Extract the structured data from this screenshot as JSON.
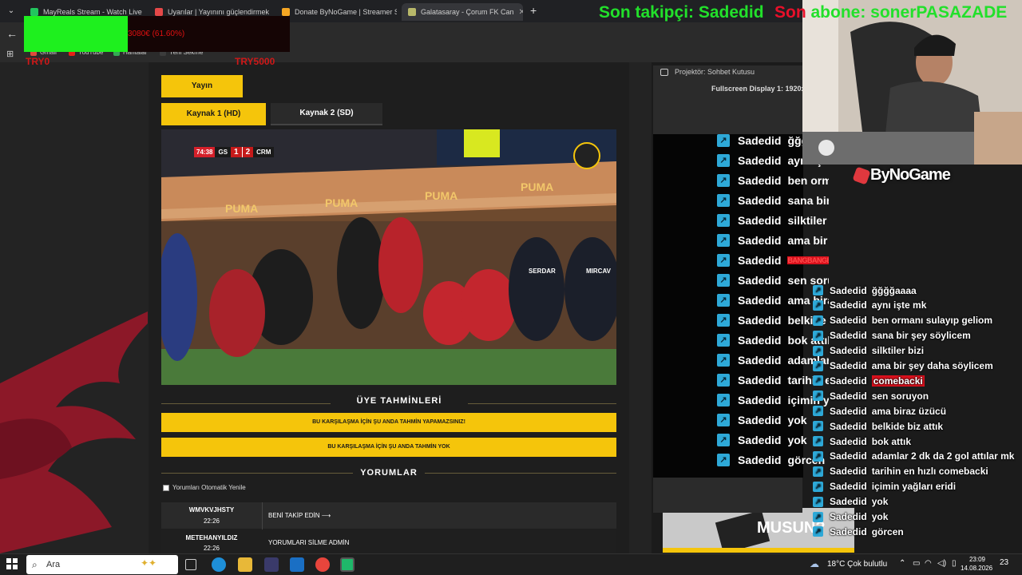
{
  "browser": {
    "tabs": [
      {
        "title": "MayReals Stream - Watch Live",
        "favicon_color": "#22c55e"
      },
      {
        "title": "Uyarılar | Yayınını güçlendirmek",
        "favicon_color": "#e54848"
      },
      {
        "title": "Donate ByNoGame | Streamer S",
        "favicon_color": "#f5a623"
      },
      {
        "title": "Galatasaray - Çorum FK Can",
        "favicon_color": "#b8b86a"
      }
    ],
    "bookmarks": [
      "Gmail",
      "YouTube",
      "Haritalar",
      "Yeni Sekme"
    ]
  },
  "goal": {
    "amount_text": "3080€ (61.60%)",
    "progress": 0.616,
    "left_label": "TRY0",
    "right_label": "TRY5000"
  },
  "alerts": {
    "follower": "Son takipçi: Sadedid",
    "subscriber_prefix": "Son",
    "subscriber_rest": " abone: sonerPASAZADE"
  },
  "page": {
    "stream_button": "Yayın",
    "source_hd": "Kaynak 1 (HD)",
    "source_sd": "Kaynak 2 (SD)",
    "predictions_title": "ÜYE TAHMİNLERİ",
    "prediction_notice_1": "BU KARŞILAŞMA İÇİN ŞU ANDA TAHMİN YAPAMAZSINIZ!",
    "prediction_notice_2": "BU KARŞILAŞMA İÇİN ŞU ANDA TAHMİN YOK",
    "comments_title": "YORUMLAR",
    "auto_refresh_label": "Yorumları Otomatik Yenile",
    "comments": [
      {
        "user": "WMVKVJHSTY",
        "time": "22:26",
        "text": "BENİ TAKİP EDİN ⟶"
      },
      {
        "user": "METEHANYILDIZ",
        "time": "22:26",
        "text": "YORUMLARI SİLME ADMİN"
      }
    ],
    "ad_text": "MUSUN?"
  },
  "video": {
    "minute": "74:38",
    "home": "GS",
    "home_score": "1",
    "away_score": "2",
    "away": "CRM",
    "shirt_texts": [
      "SERDAR",
      "MIRCAV"
    ],
    "ad_board": "PUMA"
  },
  "projector": {
    "title": "Projektör: Sohbet Kutusu",
    "display": "Fullscreen Display 1: 1920x"
  },
  "chat_big": [
    {
      "user": "Sadedid",
      "msg": "ğğğaaaa"
    },
    {
      "user": "Sadedid",
      "msg": "aynı işte mk"
    },
    {
      "user": "Sadedid",
      "msg": "ben ormanı sulayıp geliom"
    },
    {
      "user": "Sadedid",
      "msg": "sana bir şey söylicem"
    },
    {
      "user": "Sadedid",
      "msg": "silktiler bizi"
    },
    {
      "user": "Sadedid",
      "msg": "ama bir şey daha söylicem"
    },
    {
      "user": "Sadedid",
      "msg": "BANGBANGBANGBANGBANG",
      "red": true
    },
    {
      "user": "Sadedid",
      "msg": "sen soruyon"
    },
    {
      "user": "Sadedid",
      "msg": "ama biraz üzücü"
    },
    {
      "user": "Sadedid",
      "msg": "belkide biz attık"
    },
    {
      "user": "Sadedid",
      "msg": "bok attık"
    },
    {
      "user": "Sadedid",
      "msg": "adamlar 2 dk da 2 gol attılar mk"
    },
    {
      "user": "Sadedid",
      "msg": "tarihin en hızlı comebacki"
    },
    {
      "user": "Sadedid",
      "msg": "içimin yağları eridi"
    },
    {
      "user": "Sadedid",
      "msg": "yok"
    },
    {
      "user": "Sadedid",
      "msg": "yok"
    },
    {
      "user": "Sadedid",
      "msg": "görcen"
    }
  ],
  "chat_small": [
    {
      "user": "Sadedid",
      "msg": "ğğğğaaaa"
    },
    {
      "user": "Sadedid",
      "msg": "aynı işte mk"
    },
    {
      "user": "Sadedid",
      "msg": "ben ormanı sulayıp geliom"
    },
    {
      "user": "Sadedid",
      "msg": "sana bir şey söylicem"
    },
    {
      "user": "Sadedid",
      "msg": "silktiler bizi"
    },
    {
      "user": "Sadedid",
      "msg": "ama bir şey daha söylicem"
    },
    {
      "user": "Sadedid",
      "msg": "comebacki",
      "red": true
    },
    {
      "user": "Sadedid",
      "msg": "sen soruyon"
    },
    {
      "user": "Sadedid",
      "msg": "ama biraz üzücü"
    },
    {
      "user": "Sadedid",
      "msg": "belkide biz attık"
    },
    {
      "user": "Sadedid",
      "msg": "bok attık"
    },
    {
      "user": "Sadedid",
      "msg": "adamlar 2 dk da 2 gol attılar mk"
    },
    {
      "user": "Sadedid",
      "msg": "tarihin en hızlı comebacki"
    },
    {
      "user": "Sadedid",
      "msg": "içimin yağları eridi"
    },
    {
      "user": "Sadedid",
      "msg": "yok"
    },
    {
      "user": "Sadedid",
      "msg": "yok"
    },
    {
      "user": "Sadedid",
      "msg": "görcen"
    }
  ],
  "webcam": {
    "logo_text": "ByNoGame"
  },
  "taskbar": {
    "search_placeholder": "Ara",
    "weather": "18°C  Çok bulutlu",
    "time": "23:09",
    "date": "14.08.2026",
    "notif_count": "23"
  },
  "colors": {
    "accent": "#f5c50b",
    "chat_icon": "#2ea9d8",
    "alert_green": "#22e02b"
  }
}
